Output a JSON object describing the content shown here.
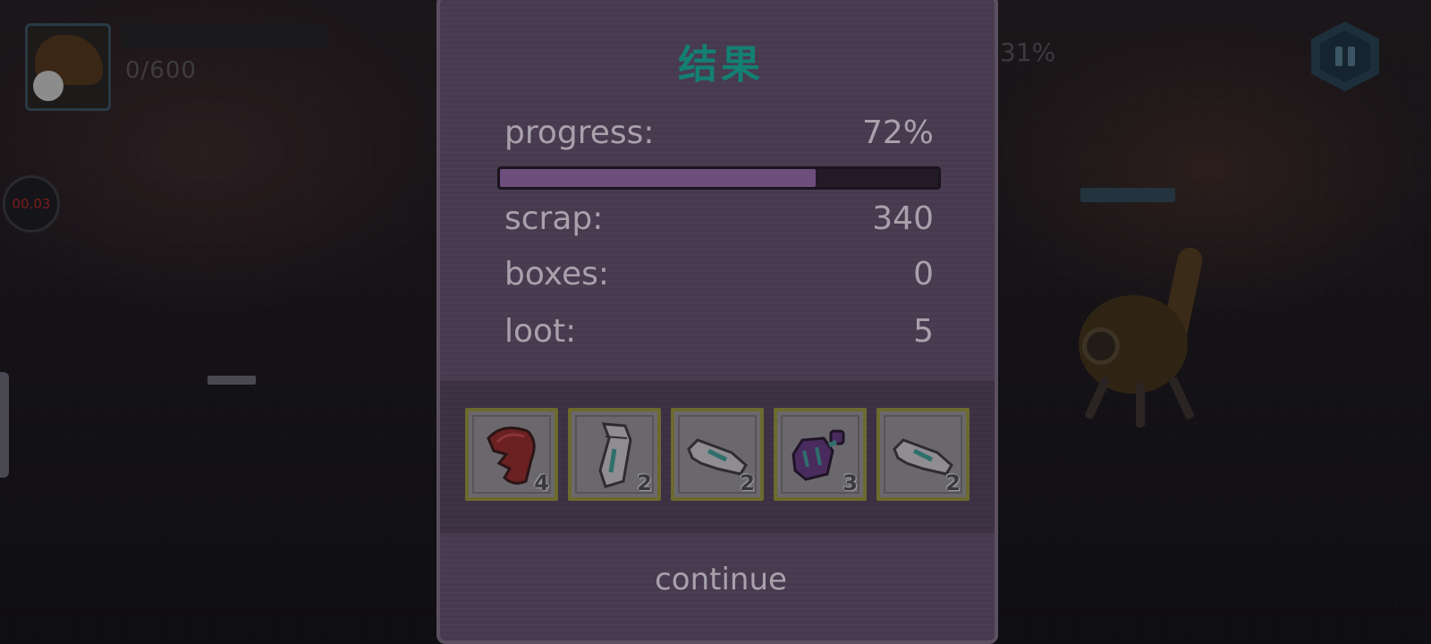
{
  "hud": {
    "hp_text": "0/600",
    "timer": "00.03",
    "right_percent": "31%",
    "pause_icon": "pause-icon"
  },
  "results": {
    "title": "结果",
    "progress_label": "progress:",
    "progress_value": "72%",
    "progress_fraction": 0.72,
    "scrap_label": "scrap:",
    "scrap_value": "340",
    "boxes_label": "boxes:",
    "boxes_value": "0",
    "loot_label": "loot:",
    "loot_value": "5",
    "loot_items": [
      {
        "icon": "red-armor-piece-icon",
        "count": "4"
      },
      {
        "icon": "gray-leg-plate-icon",
        "count": "2"
      },
      {
        "icon": "gray-blade-part-icon",
        "count": "2"
      },
      {
        "icon": "purple-canister-icon",
        "count": "3"
      },
      {
        "icon": "gray-blade-part-icon",
        "count": "2"
      }
    ],
    "continue_label": "continue"
  },
  "colors": {
    "title": "#138073",
    "panel": "#47394e",
    "progress_fill": "#6e4e7c",
    "slot_border": "#6c6a2d"
  }
}
